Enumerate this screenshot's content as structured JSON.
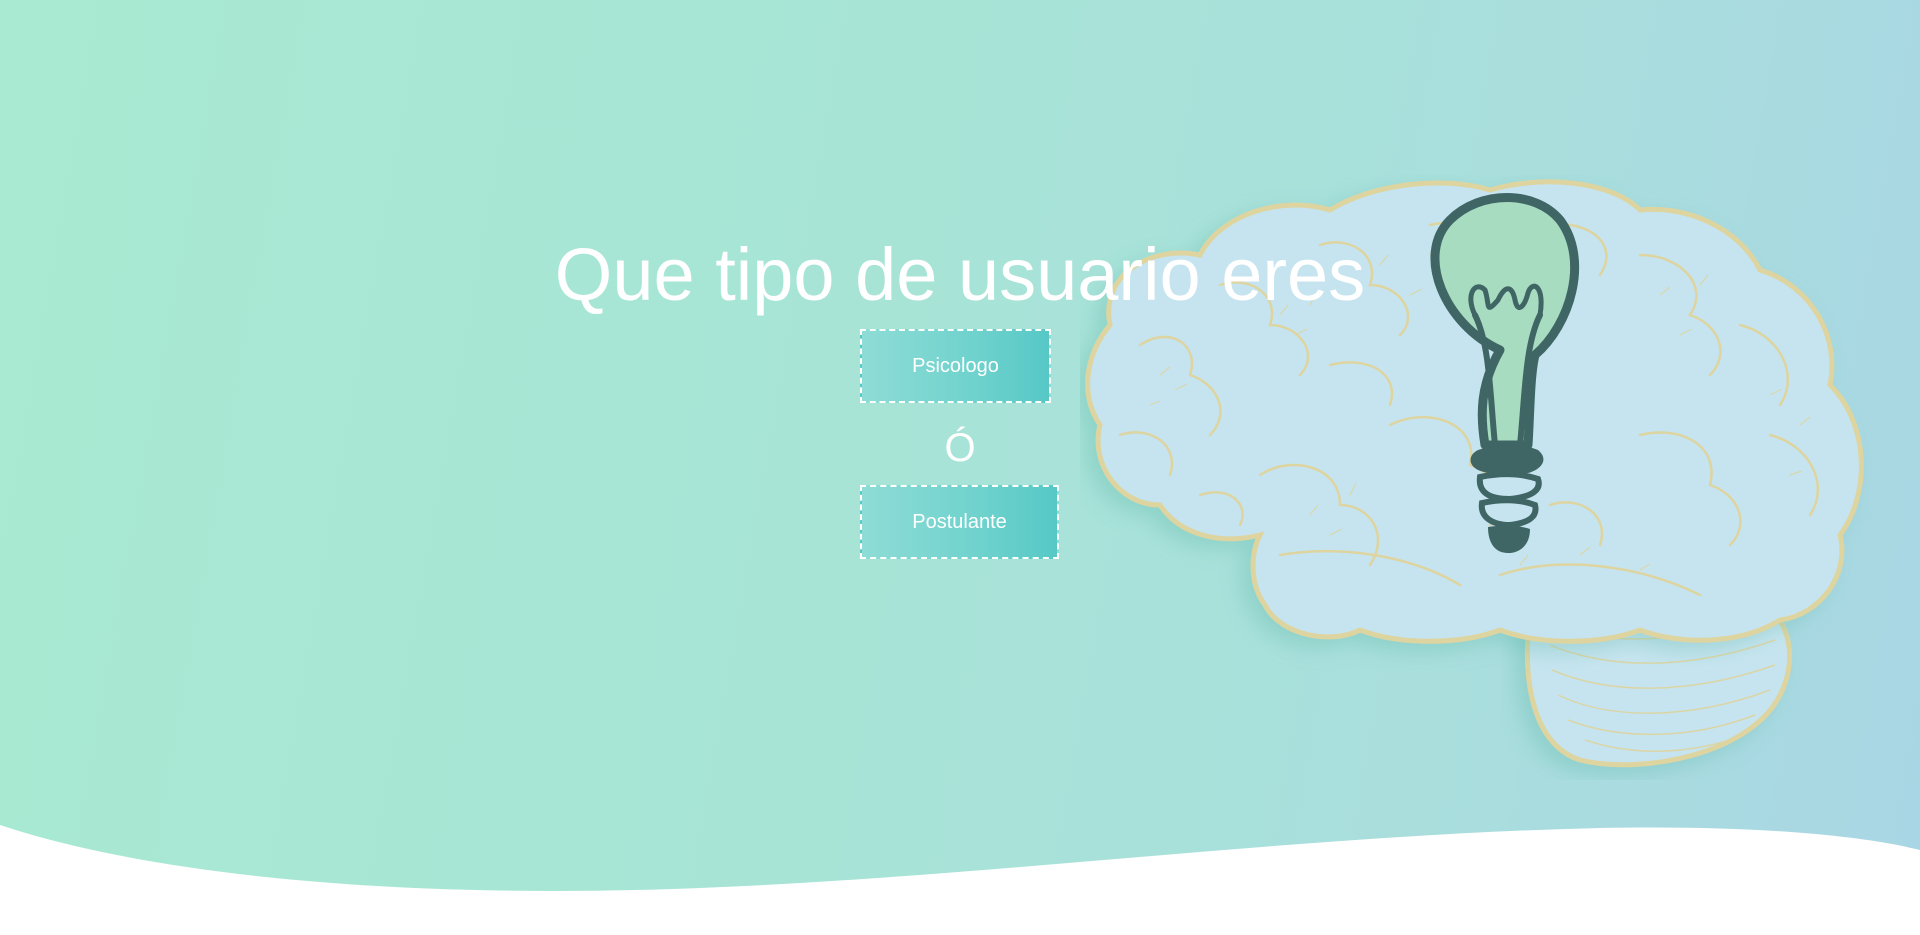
{
  "hero": {
    "title": "Que tipo de usuario eres",
    "separator": "Ó"
  },
  "buttons": {
    "psicologo_label": "Psicologo",
    "postulante_label": "Postulante"
  },
  "illustration": {
    "subject": "brain-with-lightbulb-illustration",
    "colors": {
      "brain_fill": "#c6e4ef",
      "brain_outline": "#ddd4a0",
      "bulb_fill": "#a7dcc0",
      "bulb_stroke": "#3f6664"
    }
  },
  "theme": {
    "gradient_start": "#a8ead2",
    "gradient_end": "#a9d6e4",
    "button_accent": "#56c8c6",
    "text_color": "#ffffff"
  }
}
